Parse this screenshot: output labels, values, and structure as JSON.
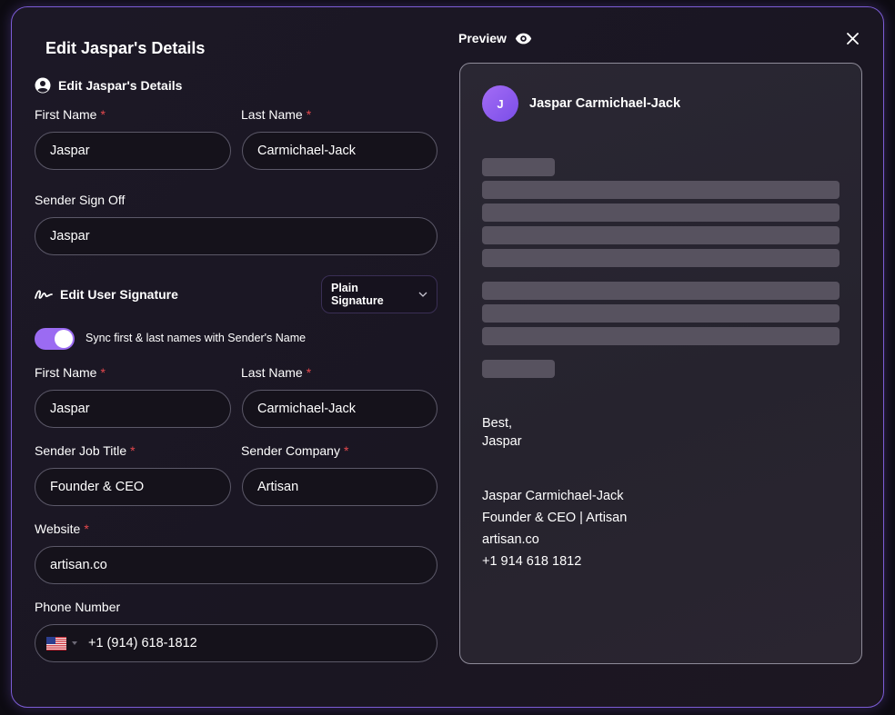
{
  "dialog": {
    "title": "Edit Jaspar's Details",
    "close_icon": "close-icon"
  },
  "details_section": {
    "heading": "Edit Jaspar's Details",
    "icon": "user-circle-icon",
    "first_name_label": "First Name",
    "first_name_value": "Jaspar",
    "last_name_label": "Last Name",
    "last_name_value": "Carmichael-Jack",
    "required_mark": "*",
    "sign_off_label": "Sender Sign Off",
    "sign_off_value": "Jaspar"
  },
  "signature_section": {
    "heading": "Edit User Signature",
    "icon": "signature-icon",
    "dropdown_value": "Plain Signature",
    "sync_label": "Sync first & last names with Sender's Name",
    "sync_enabled": true,
    "first_name_label": "First Name",
    "first_name_value": "Jaspar",
    "last_name_label": "Last Name",
    "last_name_value": "Carmichael-Jack",
    "job_title_label": "Sender Job Title",
    "job_title_value": "Founder & CEO",
    "company_label": "Sender Company",
    "company_value": "Artisan",
    "website_label": "Website",
    "website_value": "artisan.co",
    "phone_label": "Phone Number",
    "phone_value": "+1 (914) 618-1812",
    "phone_country_icon": "us-flag-icon"
  },
  "preview": {
    "label": "Preview",
    "icon": "eye-icon",
    "avatar_initial": "J",
    "sender_name": "Jaspar Carmichael-Jack",
    "closing": "Best,",
    "closing_name": "Jaspar",
    "sig_name": "Jaspar Carmichael-Jack",
    "sig_title_company": "Founder & CEO | Artisan",
    "sig_website": "artisan.co",
    "sig_phone": "+1 914 618 1812"
  },
  "colors": {
    "accent": "#9b6bf2",
    "border": "#7c5cd6",
    "required": "#e5484d",
    "placeholder_bar": "#57525f"
  }
}
